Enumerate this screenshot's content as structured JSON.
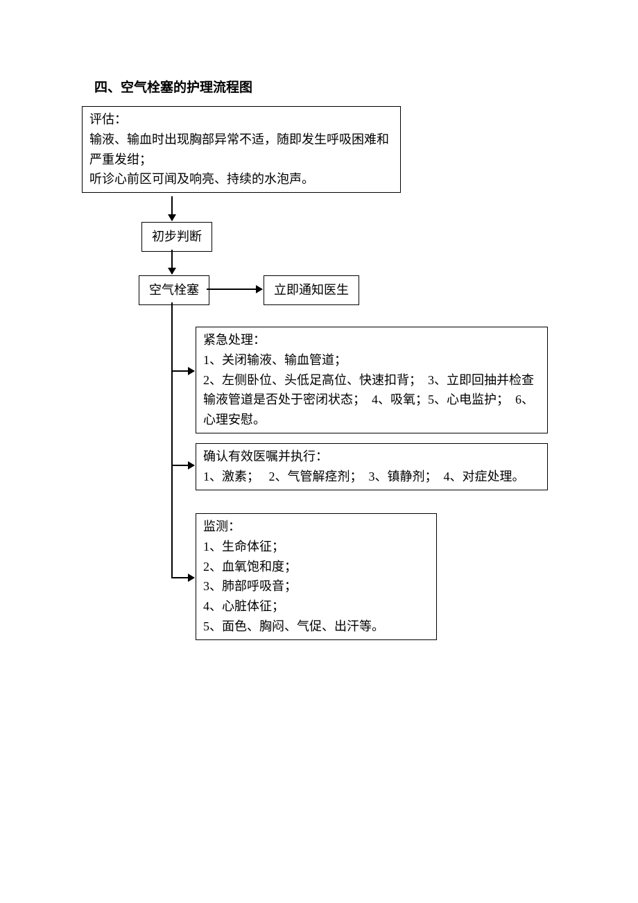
{
  "title": "四、空气栓塞的护理流程图",
  "assess": "评估：\n输液、输血时出现胸部异常不适，随即发生呼吸困难和严重发绀；\n听诊心前区可闻及响亮、持续的水泡声。",
  "prelim": "初步判断",
  "diag": "空气栓塞",
  "notify": "立即通知医生",
  "emergency": "紧急处理：\n1、关闭输液、输血管道；\n2、左侧卧位、头低足高位、快速扣背；  3、立即回抽并检查输液管道是否处于密闭状态；  4、吸氧；5、心电监护；  6、心理安慰。",
  "orders": "确认有效医嘱并执行：\n1、激素；   2、气管解痉剂；  3、镇静剂；  4、对症处理。",
  "monitor": "监测：\n1、生命体征；\n2、血氧饱和度；\n3、肺部呼吸音；\n4、心脏体征；\n5、面色、胸闷、气促、出汗等。"
}
